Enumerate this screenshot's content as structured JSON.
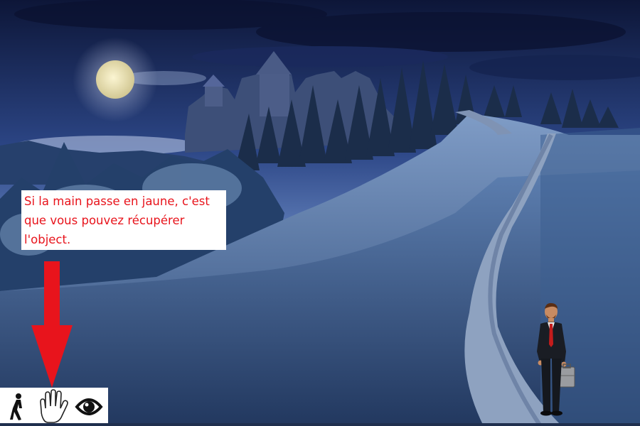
{
  "scene": {
    "name": "night-hill-castle-path",
    "colors": {
      "sky_top": "#0f1a3d",
      "sky_mid": "#3a5a9a",
      "hill": "#4a6fa0",
      "path": "#8fa2bf",
      "moon": "#e8e0b0"
    }
  },
  "hint": {
    "text": "Si la main passe en jaune, c'est que vous pouvez récupérer l'object.",
    "color": "#e8141c"
  },
  "arrow": {
    "color": "#e8141c",
    "direction": "down"
  },
  "action_bar": {
    "buttons": [
      {
        "name": "walk",
        "icon": "walk-icon"
      },
      {
        "name": "take",
        "icon": "hand-icon"
      },
      {
        "name": "look",
        "icon": "eye-icon"
      }
    ]
  },
  "character": {
    "description_icon": "businessman-with-briefcase"
  }
}
